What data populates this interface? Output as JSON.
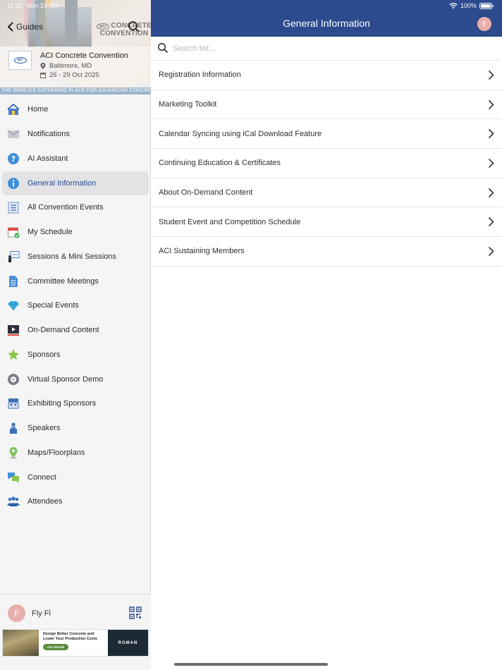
{
  "status_bar": {
    "time": "11:32",
    "date": "Mon 13 Oct",
    "battery": "100%"
  },
  "sidebar": {
    "back_label": "Guides",
    "banner_logo_line1": "CONCRETE",
    "banner_logo_line2": "CONVENTION",
    "banner_logo_badge": "aci",
    "event_logo_badge": "aci",
    "event": {
      "title": "ACI Concrete Convention",
      "location": "Baltimore, MD",
      "dates": "26 - 29 Oct 2025"
    },
    "tagline": "THE WORLD'S GATHERING PLACE FOR ADVANCING CONCRETE",
    "items": [
      {
        "label": "Home",
        "icon": "home-icon"
      },
      {
        "label": "Notifications",
        "icon": "envelope-icon"
      },
      {
        "label": "AI Assistant",
        "icon": "question-icon"
      },
      {
        "label": "General Information",
        "icon": "info-icon",
        "active": true
      },
      {
        "label": "All Convention Events",
        "icon": "list-icon"
      },
      {
        "label": "My Schedule",
        "icon": "calendar-check-icon"
      },
      {
        "label": "Sessions & Mini Sessions",
        "icon": "presentation-icon"
      },
      {
        "label": "Committee Meetings",
        "icon": "document-icon"
      },
      {
        "label": "Special Events",
        "icon": "diamond-icon"
      },
      {
        "label": "On-Demand Content",
        "icon": "video-icon"
      },
      {
        "label": "Sponsors",
        "icon": "star-icon"
      },
      {
        "label": "Virtual Sponsor Demo",
        "icon": "play-circle-icon"
      },
      {
        "label": "Exhibiting Sponsors",
        "icon": "booth-icon"
      },
      {
        "label": "Speakers",
        "icon": "speaker-icon"
      },
      {
        "label": "Maps/Floorplans",
        "icon": "map-pin-icon"
      },
      {
        "label": "Connect",
        "icon": "chat-icon"
      },
      {
        "label": "Attendees",
        "icon": "people-icon"
      }
    ],
    "user": {
      "initial": "F",
      "name": "Fly Fl"
    },
    "ad": {
      "headline": "Design Better Concrete and Lower Your Production Costs",
      "cta": "Get Started",
      "brand": "ROMAN"
    }
  },
  "main": {
    "title": "General Information",
    "avatar_initial": "F",
    "search": {
      "placeholder": "Search list...",
      "value": ""
    },
    "items": [
      "Registration Information",
      "Marketing Toolkit",
      "Calendar Syncing using iCal Download Feature",
      "Continuing Education & Certificates",
      "About On-Demand Content",
      "Student Event and Competition Schedule",
      "ACI Sustaining Members"
    ]
  },
  "colors": {
    "brand_blue": "#2c4a8e",
    "active_bg": "#e3e3e6",
    "avatar": "#e8aeab"
  }
}
